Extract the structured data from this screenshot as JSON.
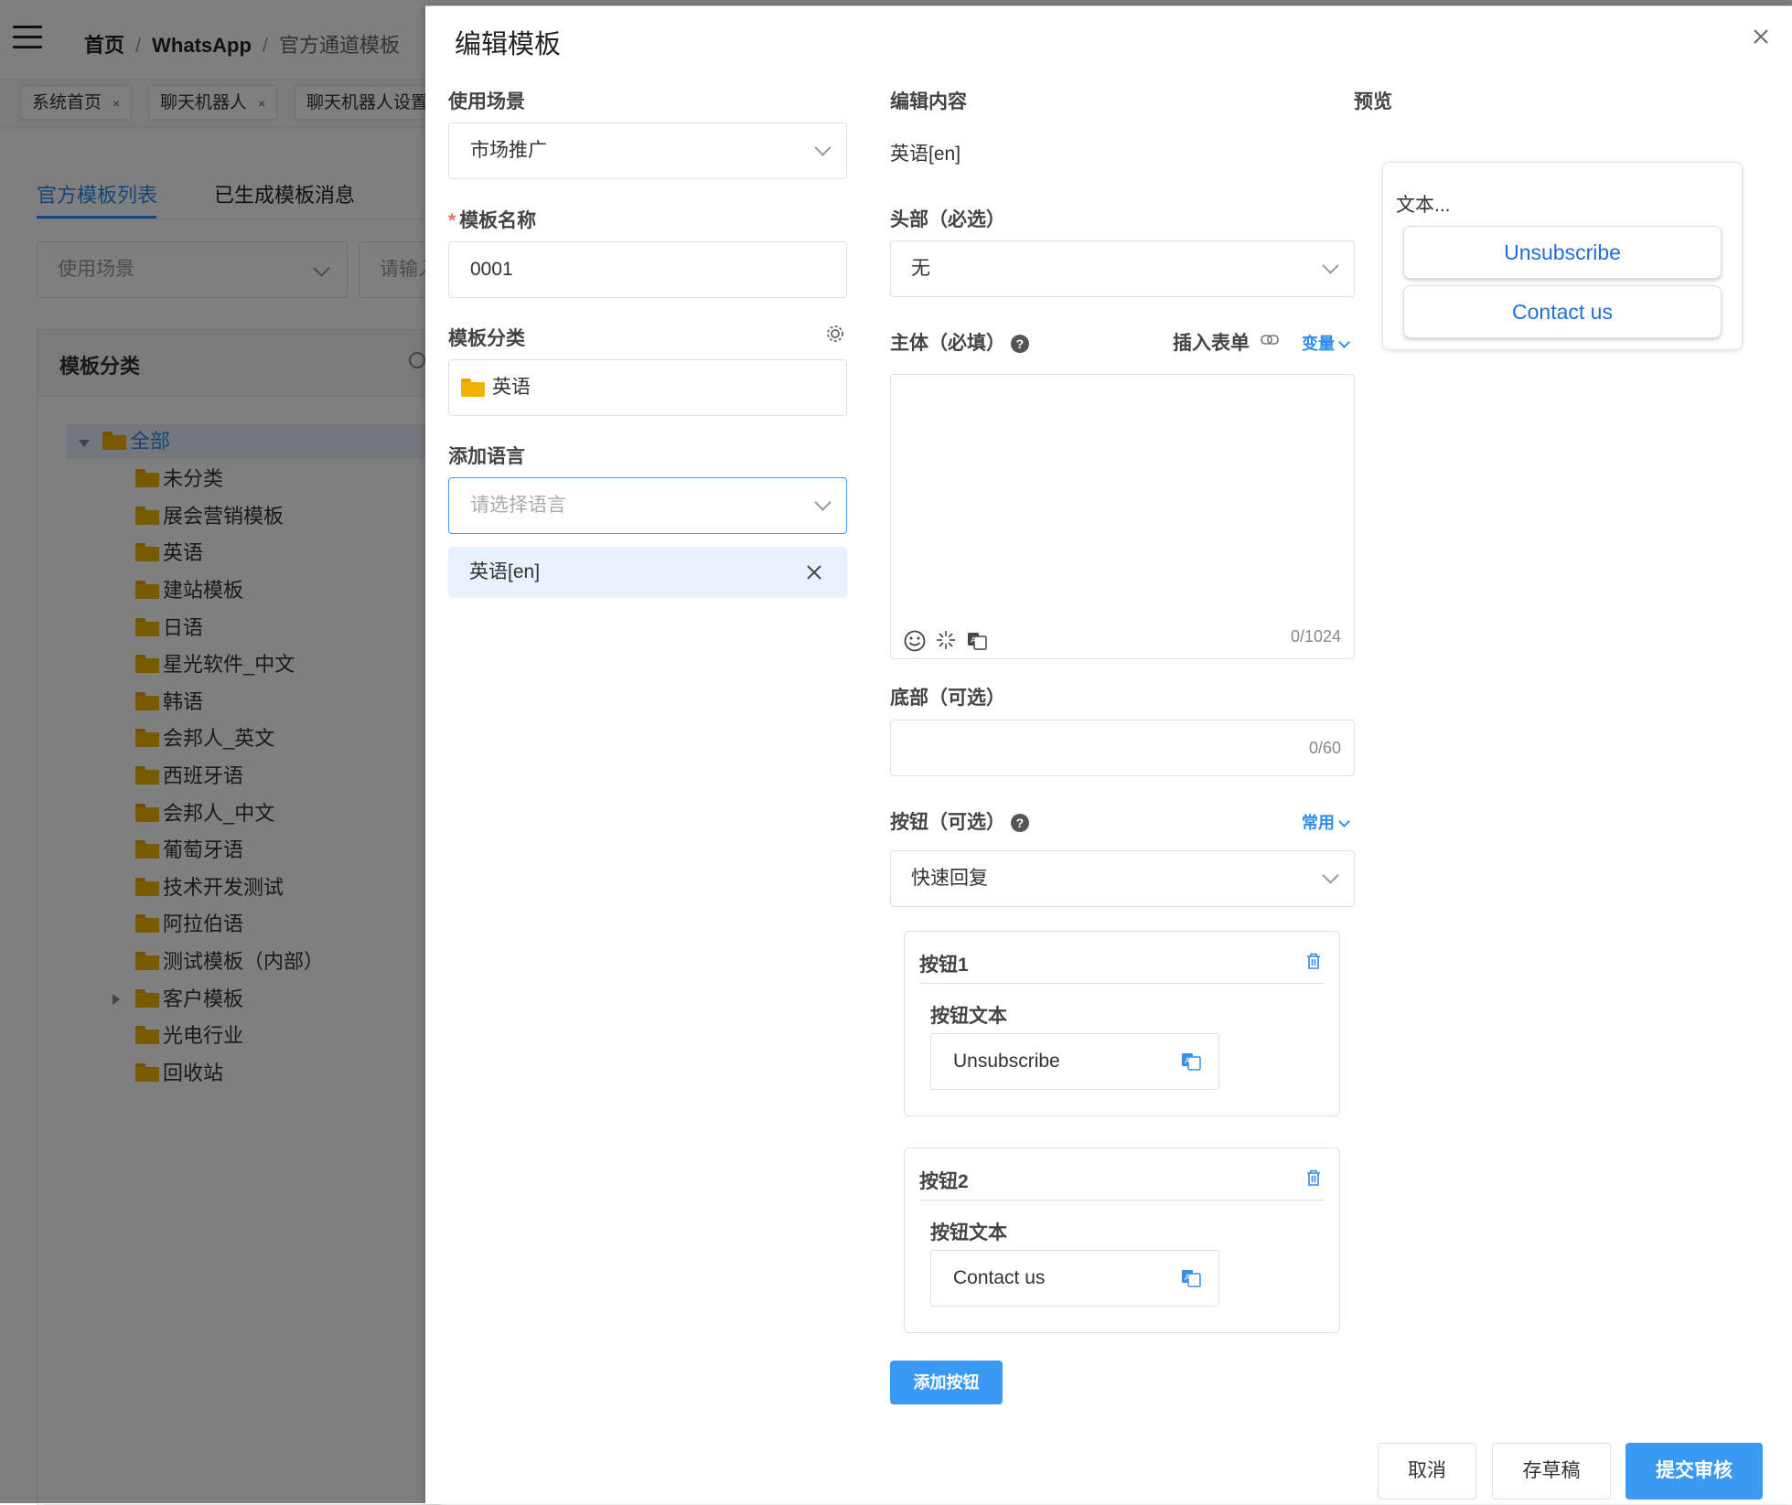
{
  "breadcrumb": {
    "home": "首页",
    "sep": "/",
    "section": "WhatsApp",
    "page": "官方通道模板"
  },
  "open_tags": [
    {
      "label": "系统首页",
      "close": "×"
    },
    {
      "label": "聊天机器人",
      "close": "×"
    },
    {
      "label": "聊天机器人设置"
    }
  ],
  "page_tabs": [
    "官方模板列表",
    "已生成模板消息"
  ],
  "filters": {
    "scene_placeholder": "使用场景",
    "search_placeholder": "请输入"
  },
  "category_panel": {
    "title": "模板分类",
    "tree": [
      "全部",
      "未分类",
      "展会营销模板",
      "英语",
      "建站模板",
      "日语",
      "星光软件_中文",
      "韩语",
      "会邦人_英文",
      "西班牙语",
      "会邦人_中文",
      "葡萄牙语",
      "技术开发测试",
      "阿拉伯语",
      "测试模板（内部）",
      "客户模板",
      "光电行业",
      "回收站"
    ]
  },
  "drawer": {
    "title": "编辑模板",
    "close_icon": "close-icon",
    "left": {
      "scene_label": "使用场景",
      "scene_value": "市场推广",
      "name_required": "*",
      "name_label": "模板名称",
      "name_value": "0001",
      "category_label": "模板分类",
      "category_value": "英语",
      "lang_label": "添加语言",
      "lang_placeholder": "请选择语言",
      "lang_chip": "英语[en]"
    },
    "middle": {
      "title": "编辑内容",
      "language": "英语[en]",
      "header_label": "头部（必选）",
      "header_value": "无",
      "body_label": "主体（必填）",
      "help_glyph": "?",
      "insert_form": "插入表单",
      "variable": "变量",
      "body_value": "",
      "body_counter": "0/1024",
      "footer_label": "底部（可选）",
      "footer_counter": "0/60",
      "buttons_label": "按钮（可选）",
      "common": "常用",
      "button_type": "快速回复",
      "buttons": [
        {
          "title": "按钮1",
          "text_label": "按钮文本",
          "value": "Unsubscribe"
        },
        {
          "title": "按钮2",
          "text_label": "按钮文本",
          "value": "Contact us"
        }
      ],
      "add_button": "添加按钮"
    },
    "preview": {
      "title": "预览",
      "text": "文本...",
      "buttons": [
        "Unsubscribe",
        "Contact us"
      ]
    },
    "actions": {
      "cancel": "取消",
      "draft": "存草稿",
      "submit": "提交审核"
    }
  },
  "colors": {
    "primary": "#3a9af3",
    "link": "#2d8cf0",
    "folder": "#f0b400",
    "required": "#f56c6c"
  }
}
